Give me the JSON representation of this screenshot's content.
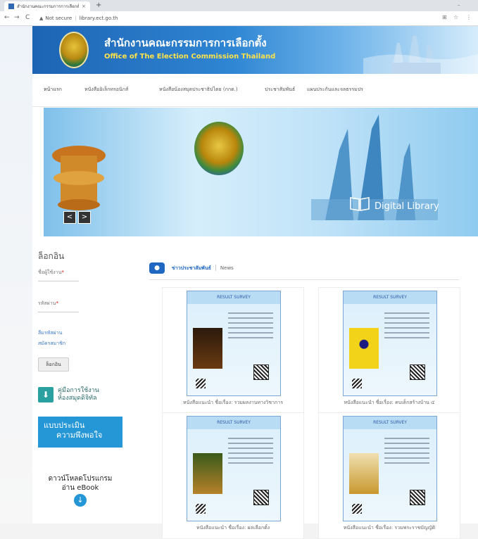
{
  "browser": {
    "tab_title": "สำนักงานคณะกรรมการการเลือกตั้ง",
    "tab_close": "×",
    "new_tab": "+",
    "back": "←",
    "forward": "→",
    "reload": "C",
    "not_secure": "Not secure",
    "url": "library.ect.go.th"
  },
  "header": {
    "title_th": "สำนักงานคณะกรรมการการเลือกตั้ง",
    "title_en": "Office of The Election Commission Thailand"
  },
  "menu": [
    {
      "label": "หน้าแรก"
    },
    {
      "label": "หนังสืออิเล็กทรอนิกส์"
    },
    {
      "label": "หนังสือน้องสมุดประชาธิปไตย (กกต.)"
    },
    {
      "label": "ประชาสัมพันธ์"
    },
    {
      "label": "แผนประกันและจลธรรมปร"
    }
  ],
  "banner": {
    "label": "Digital Library",
    "prev": "<",
    "next": ">"
  },
  "sidebar": {
    "login_title": "ล็อกอิน",
    "username_label": "ชื่อผู้ใช้งาน",
    "password_label": "รหัสผ่าน",
    "required_mark": "*",
    "link_forgot": "ลืมรหัสผ่าน",
    "link_register": "สมัครสมาชิก",
    "login_button": "ล็อกอิน",
    "manual_line1": "คู่มือการใช้งาน",
    "manual_line2": "ห้องสมุดดิจิทัล",
    "survey_line1": "แบบประเมิน",
    "survey_line2": "ความพึงพอใจ",
    "ebook_line1": "ดาวน์โหลดโปรแกรม",
    "ebook_line2": "อ่าน eBook"
  },
  "news": {
    "title_th": "ข่าวประชาสัมพันธ์",
    "title_en": "News",
    "poster_header": "RESULT SURVEY",
    "cards": [
      {
        "caption": "หนังสือแนะนำ ชื่อเรื่อง: รวมผลงานทางวิชาการ"
      },
      {
        "caption": "หนังสือแนะนำ ชื่อเรื่อง: คบเด็กสร้างบ้าน ๔"
      },
      {
        "caption": "หนังสือแนะนำ ชื่อเรื่อง: ผลเลือกตั้ง"
      },
      {
        "caption": "หนังสือแนะนำ ชื่อเรื่อง: รวมพระราชบัญญัติ"
      }
    ]
  },
  "colors": {
    "header_blue": "#1d64b4",
    "accent_blue": "#2596d6",
    "title_yellow": "#ffe24a"
  }
}
